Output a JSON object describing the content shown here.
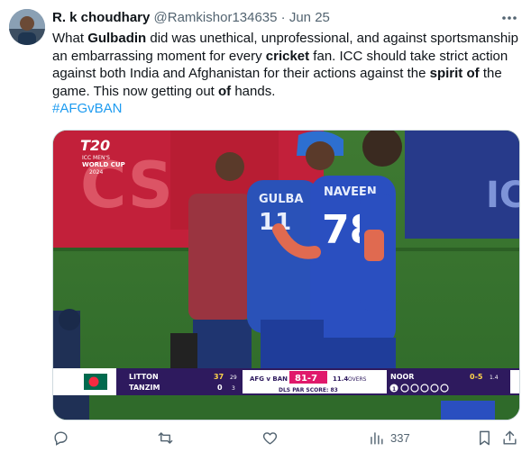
{
  "tweet": {
    "author_name": "R. k choudhary",
    "author_handle": "@Ramkishor134635",
    "separator": "·",
    "date": "Jun 25",
    "text_parts": [
      {
        "t": "What ",
        "b": false
      },
      {
        "t": "Gulbadin",
        "b": true
      },
      {
        "t": " did was unethical, unprofessional, and against sportsmanship an embarrassing moment for every ",
        "b": false
      },
      {
        "t": "cricket",
        "b": true
      },
      {
        "t": " fan. ICC should take strict action against both India and Afghanistan for their actions against the ",
        "b": false
      },
      {
        "t": "spirit",
        "b": true
      },
      {
        "t": " ",
        "b": false
      },
      {
        "t": "of",
        "b": true
      },
      {
        "t": " the game. This now getting out ",
        "b": false
      },
      {
        "t": "of",
        "b": true
      },
      {
        "t": " hands.",
        "b": false
      }
    ],
    "hashtag": "#AFGvBAN"
  },
  "media": {
    "event_logo_top": "T20",
    "event_logo_mid": "ICC MEN'S",
    "event_logo_bottom": "WORLD CUP",
    "event_logo_year": "2024",
    "jersey_1_name": "GULBA",
    "jersey_1_number": "11",
    "jersey_2_name": "NAVEEN",
    "jersey_2_number": "78",
    "scoreboard": {
      "batter_1": "LITTON",
      "batter_1_runs": "37",
      "batter_1_balls": "29",
      "batter_2": "TANZIM",
      "batter_2_runs": "0",
      "batter_2_balls": "3",
      "match": "AFG v BAN",
      "score": "81-7",
      "overs_value": "11.4",
      "overs_label": "OVERS",
      "dls_label": "DLS PAR SCORE: 83",
      "bowler": "NOOR",
      "bowler_figures": "0-5",
      "bowler_overs": "1.4",
      "over_balls": "1"
    }
  },
  "actions": {
    "views": "337"
  },
  "colors": {
    "accent": "#1d9bf0",
    "muted": "#536471",
    "scoreboard_purple": "#2e1a5e",
    "score_pink": "#e0196b"
  }
}
